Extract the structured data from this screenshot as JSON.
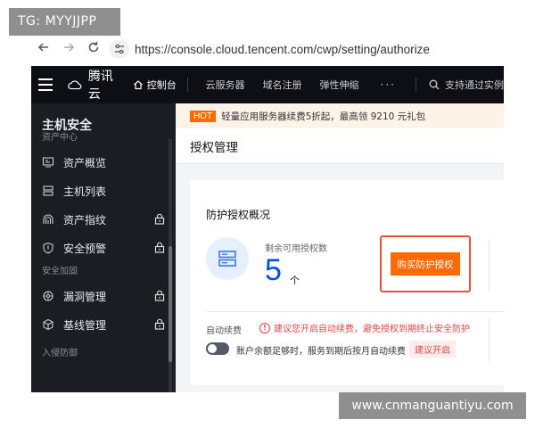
{
  "watermarks": {
    "top": "TG: MYYJJPP",
    "bottom": "www.cnmanguantiyu.com"
  },
  "browser": {
    "url": "https://console.cloud.tencent.com/cwp/setting/authorize",
    "back_icon": "arrow-left-icon",
    "forward_icon": "arrow-right-icon",
    "reload_icon": "reload-icon"
  },
  "topnav": {
    "brand": "腾讯云",
    "items": [
      {
        "label": "控制台",
        "icon": "home-icon",
        "active": true
      },
      {
        "label": "云服务器"
      },
      {
        "label": "域名注册"
      },
      {
        "label": "弹性伸缩"
      }
    ],
    "more": "···",
    "search_placeholder": "支持通过实例"
  },
  "sidebar": {
    "title": "主机安全",
    "groups": [
      {
        "label": "资产中心",
        "items": [
          {
            "label": "资产概览",
            "icon": "monitor-icon",
            "locked": false
          },
          {
            "label": "主机列表",
            "icon": "server-list-icon",
            "locked": false
          },
          {
            "label": "资产指纹",
            "icon": "fingerprint-icon",
            "locked": true
          }
        ]
      },
      {
        "label": "",
        "items": [
          {
            "label": "安全预警",
            "icon": "shield-alert-icon",
            "locked": true
          }
        ]
      },
      {
        "label": "安全加固",
        "items": [
          {
            "label": "漏洞管理",
            "icon": "bug-icon",
            "locked": true
          },
          {
            "label": "基线管理",
            "icon": "cube-icon",
            "locked": true
          }
        ]
      },
      {
        "label": "入侵防御",
        "items": []
      }
    ]
  },
  "main": {
    "hot_badge": "HOT",
    "hot_text": "轻量应用服务器续费5折起，最高领 9210 元礼包",
    "page_title": "授权管理",
    "card": {
      "title": "防护授权概况",
      "stat_label": "剩余可用授权数",
      "stat_value": "5",
      "stat_unit": "个",
      "buy_button": "购买防护授权",
      "renew_label": "自动续费",
      "renew_warning": "建议您开启自动续费，避免授权到期终止安全防护",
      "renew_desc": "账户余额足够时，服务到期后按月自动续费",
      "suggest_tag": "建议开启",
      "auto_renew_enabled": false
    }
  },
  "colors": {
    "brand_orange": "#ff6a00",
    "brand_blue": "#0052d9",
    "warning_red": "#e54545",
    "nav_bg": "#0d0f14",
    "sidebar_bg": "#1b1d22"
  }
}
